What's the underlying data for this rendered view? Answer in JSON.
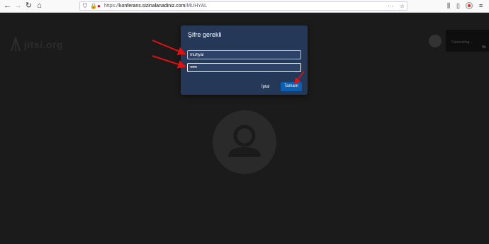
{
  "browser": {
    "url_prefix": "https://",
    "url_host": "konferans.sizinalanadiniz.com",
    "url_path": "/MUHYAL"
  },
  "app": {
    "logo_text": "jitsi.org",
    "thumbnail_label": "Connecting...",
    "thumbnail_stat": "Hb"
  },
  "dialog": {
    "title": "Şifre gerekli",
    "username_value": "muhyal",
    "password_value": "••••••",
    "cancel_label": "İptal",
    "ok_label": "Tamam"
  },
  "colors": {
    "annotation_arrow": "#e01010",
    "dialog_bg": "#253858",
    "ok_button": "#0b5fb3"
  }
}
